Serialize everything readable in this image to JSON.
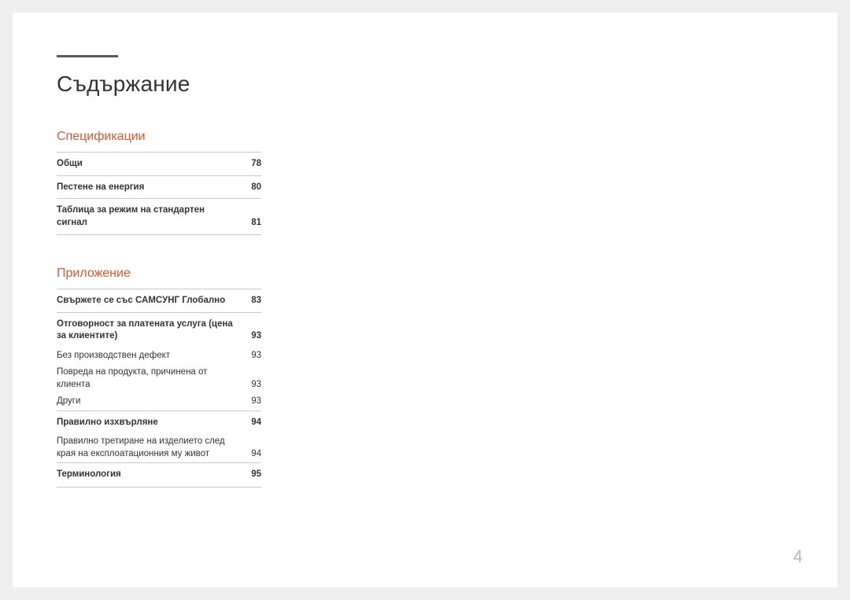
{
  "title": "Съдържание",
  "page_number": "4",
  "sections": [
    {
      "heading": "Спецификации",
      "entries": [
        {
          "label": "Общи",
          "page": "78",
          "bold": true,
          "border": true
        },
        {
          "label": "Пестене на енергия",
          "page": "80",
          "bold": true,
          "border": true
        },
        {
          "label": "Таблица за режим на стандартен сигнал",
          "page": "81",
          "bold": true,
          "border": true,
          "last": true
        }
      ]
    },
    {
      "heading": "Приложение",
      "entries": [
        {
          "label": "Свържете се със САМСУНГ Глобално",
          "page": "83",
          "bold": true,
          "border": true
        },
        {
          "label": "Отговорност за платената услуга (цена за клиентите)",
          "page": "93",
          "bold": true,
          "border": true
        },
        {
          "label": "Без производствен дефект",
          "page": "93",
          "bold": false,
          "border": false
        },
        {
          "label": "Повреда на продукта, причинена от клиента",
          "page": "93",
          "bold": false,
          "border": false
        },
        {
          "label": "Други",
          "page": "93",
          "bold": false,
          "border": false
        },
        {
          "label": "Правилно изхвърляне",
          "page": "94",
          "bold": true,
          "border": true
        },
        {
          "label": "Правилно третиране на изделието след края на експлоатационния му живот",
          "page": "94",
          "bold": false,
          "border": false
        },
        {
          "label": "Терминология",
          "page": "95",
          "bold": true,
          "border": true,
          "last": true
        }
      ]
    }
  ]
}
